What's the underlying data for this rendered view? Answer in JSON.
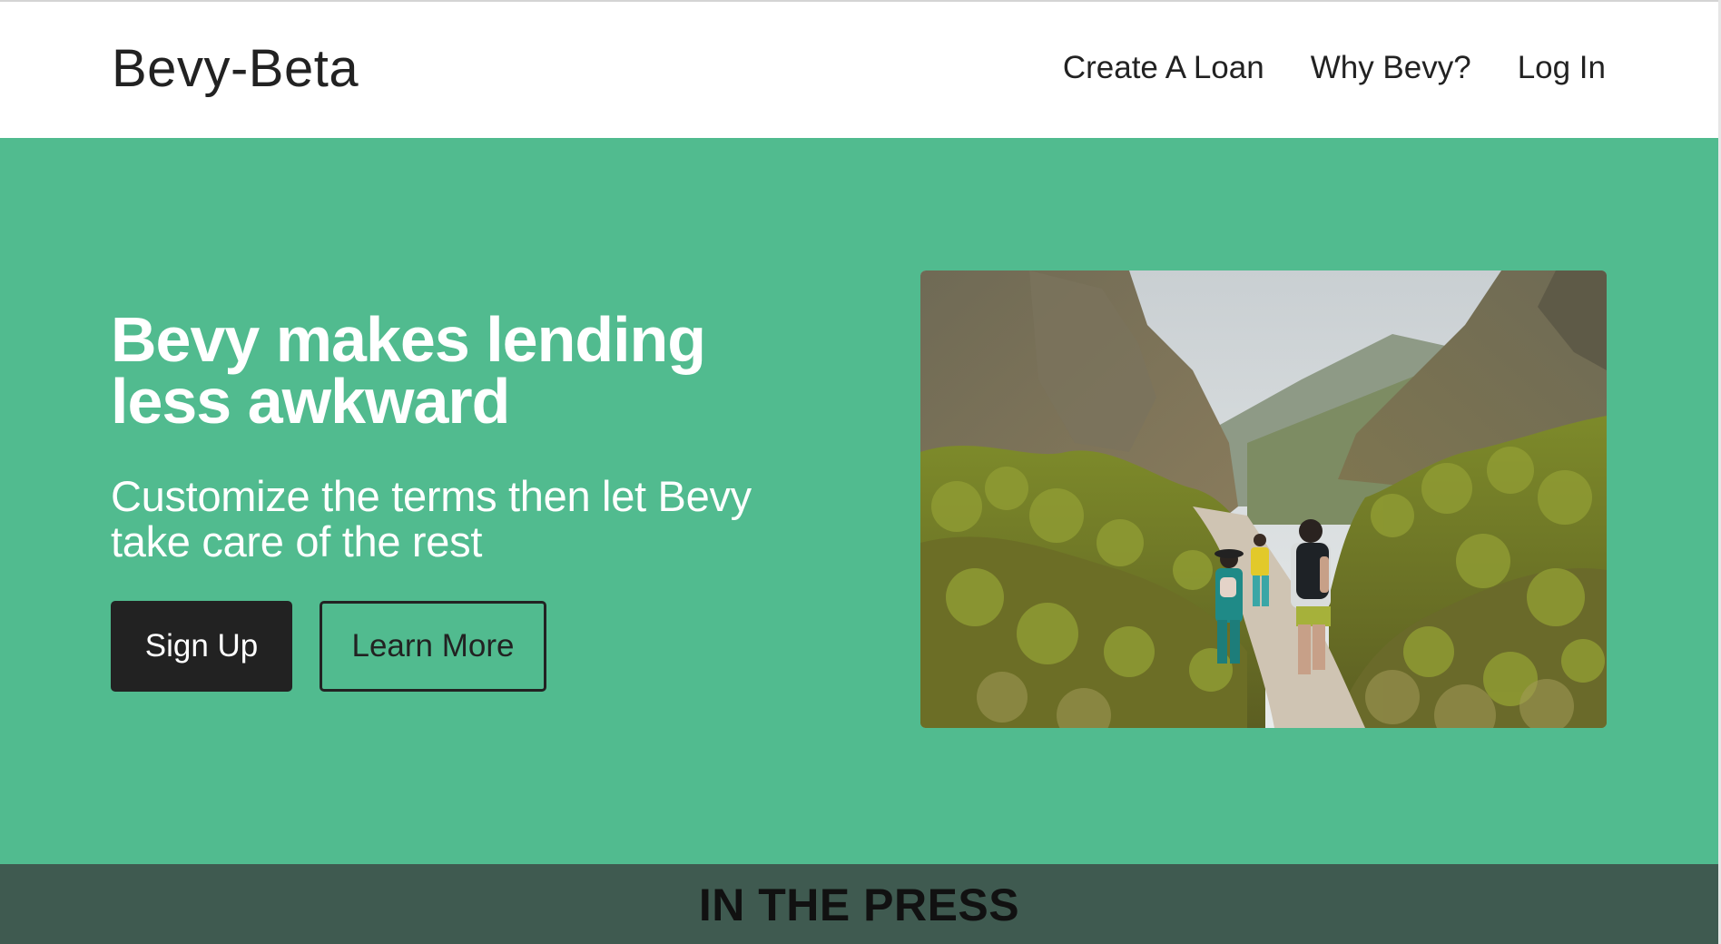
{
  "header": {
    "brand": "Bevy-Beta",
    "nav": [
      {
        "label": "Create A Loan"
      },
      {
        "label": "Why Bevy?"
      },
      {
        "label": "Log In"
      }
    ]
  },
  "hero": {
    "title": "Bevy makes lending less awkward",
    "subtitle": "Customize the terms then let Bevy take care of the rest",
    "signup_label": "Sign Up",
    "learn_more_label": "Learn More",
    "image_alt": "hikers-walking-trail-photo"
  },
  "press": {
    "title": "IN THE PRESS"
  },
  "colors": {
    "hero_bg": "#51bb8f",
    "press_bg": "#3f5a50",
    "button_dark": "#222222",
    "text_dark": "#222222"
  }
}
